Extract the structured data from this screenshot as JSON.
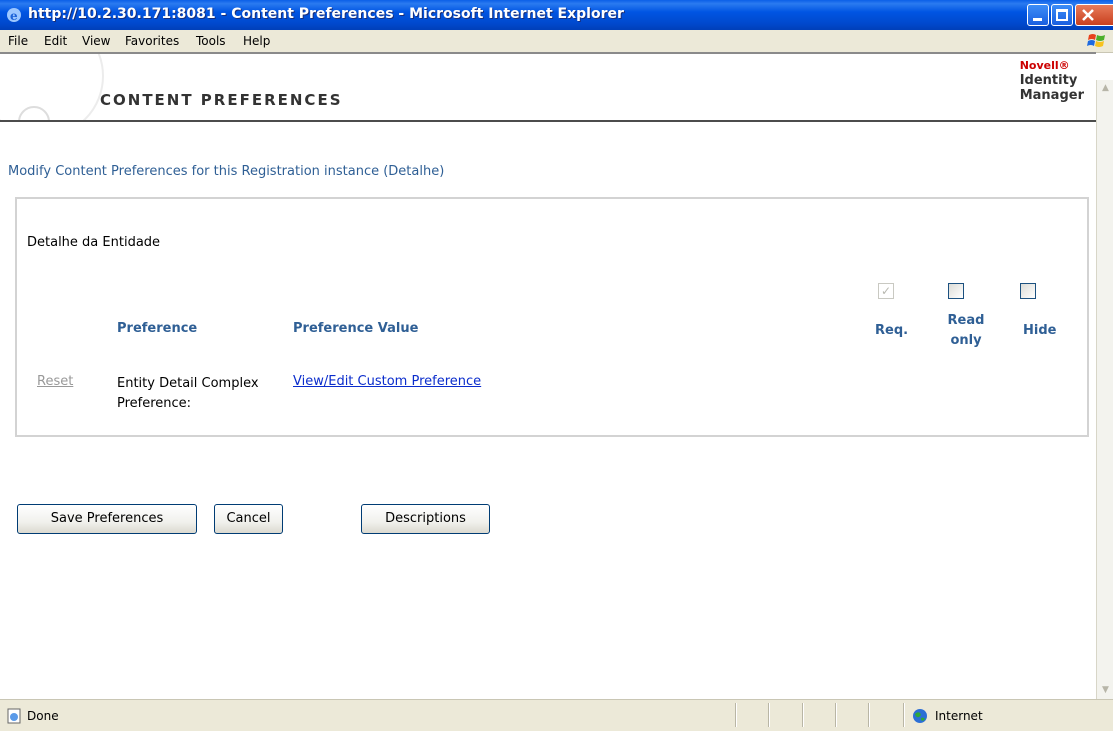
{
  "window": {
    "title": "http://10.2.30.171:8081 - Content Preferences - Microsoft Internet Explorer"
  },
  "menu": [
    "File",
    "Edit",
    "View",
    "Favorites",
    "Tools",
    "Help"
  ],
  "banner": {
    "heading": "CONTENT PREFERENCES",
    "brand_novell": "Novell®",
    "brand_line1": "Identity",
    "brand_line2": "Manager"
  },
  "page": {
    "subtitle": "Modify Content Preferences for this Registration instance (Detalhe)",
    "section_title": "Detalhe da Entidade",
    "columns": {
      "preference": "Preference",
      "value": "Preference Value",
      "req": "Req.",
      "read_only_line1": "Read",
      "read_only_line2": "only",
      "hide": "Hide"
    },
    "row": {
      "reset": "Reset",
      "name_line1": "Entity Detail Complex",
      "name_line2": "Preference:",
      "value_link": "View/Edit Custom Preference",
      "req_checked": true,
      "read_only_checked": false,
      "hide_checked": false
    }
  },
  "buttons": {
    "save": "Save Preferences",
    "cancel": "Cancel",
    "descriptions": "Descriptions"
  },
  "status": {
    "text": "Done",
    "zone": "Internet"
  },
  "colors": {
    "titlebar": "#0055e3",
    "heading_blue": "#2f5f95",
    "link_blue": "#0a2ccc"
  }
}
